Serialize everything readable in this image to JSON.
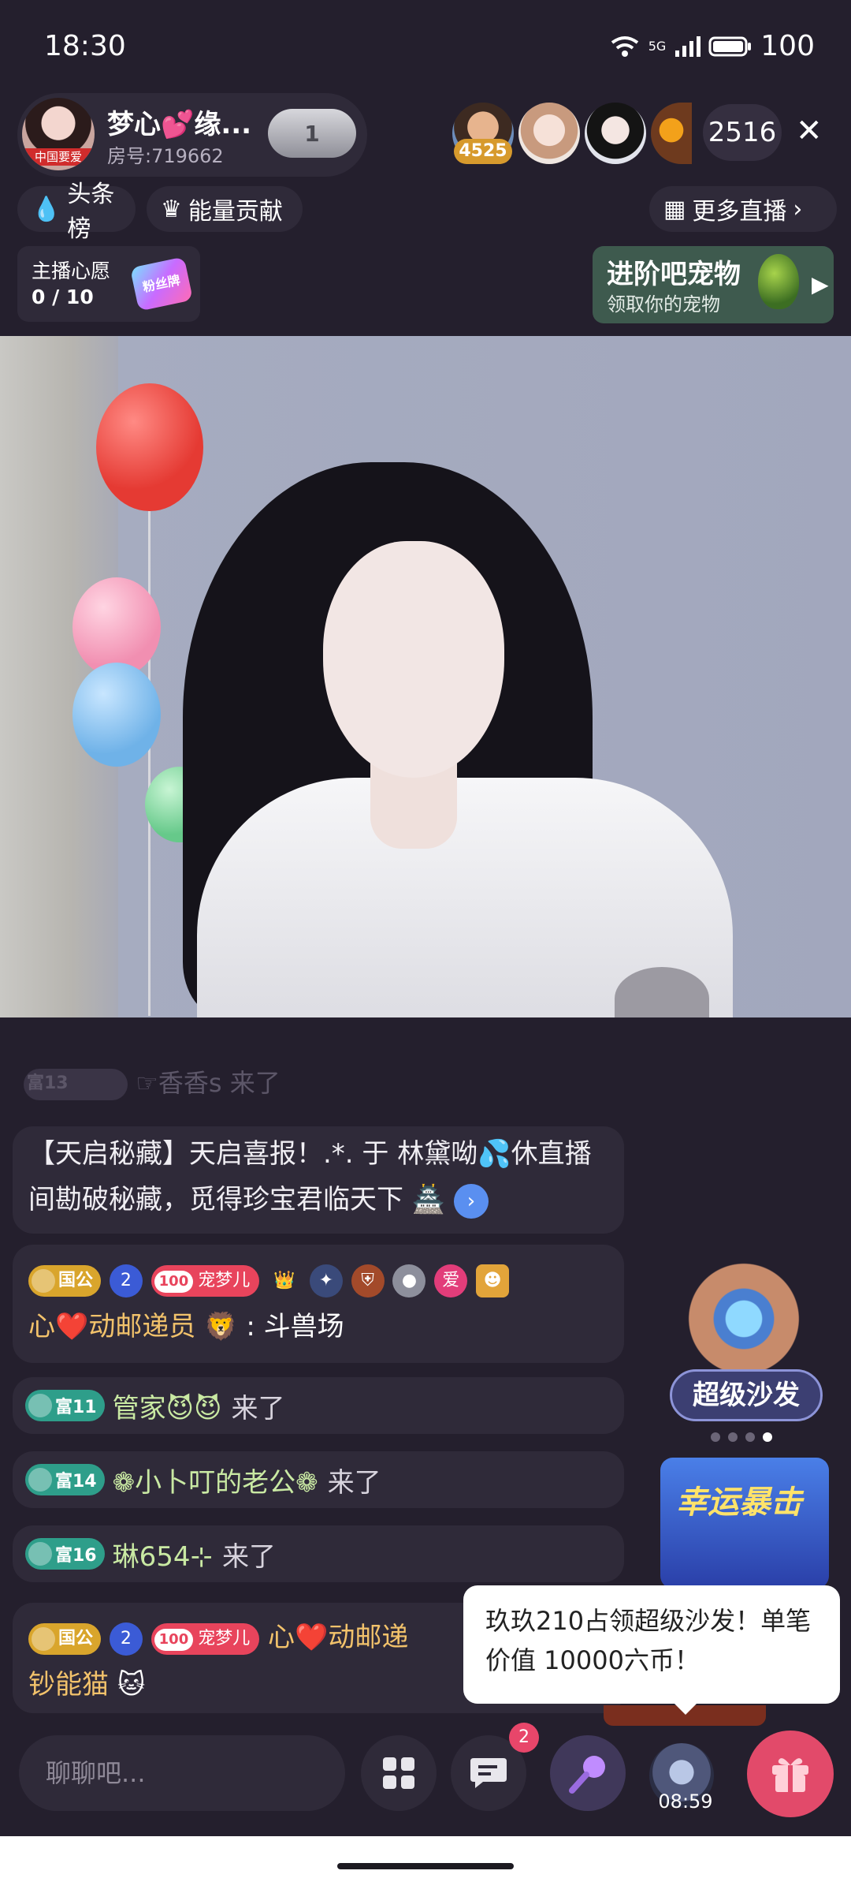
{
  "status_bar": {
    "time": "18:30",
    "battery": "100",
    "network": "5G"
  },
  "anchor": {
    "name": "梦心💕缘...",
    "room": "房号:719662",
    "fan_level": "1",
    "avatar_tag": "中国要爱"
  },
  "viewers": {
    "first_badge": "4525",
    "count": "2516"
  },
  "ranking": {
    "headline": "头条榜",
    "energy": "能量贡献",
    "more_live": "更多直播"
  },
  "wish": {
    "title": "主播心愿",
    "progress": "0 / 10",
    "gift_label": "粉丝牌"
  },
  "pet_banner": {
    "title": "进阶吧宠物",
    "subtitle": "领取你的宠物"
  },
  "chat": {
    "faded": "☞香香s 来了",
    "faded_level": "富13",
    "system": "【天启秘藏】天启喜报！.*. 于 林黛呦💦休直播间勘破秘藏，觅得珍宝君临天下",
    "msg1": {
      "country": "国公",
      "star": "2",
      "pet_num": "100",
      "pet_name": "宠梦儿",
      "love": "爱",
      "user": "心❤️动邮递员",
      "text": ": 斗兽场"
    },
    "joins": [
      {
        "level": "富11",
        "user": "管家😈😈",
        "suffix": "来了"
      },
      {
        "level": "富14",
        "user": "❁小卜叮的老公❁",
        "suffix": "来了"
      },
      {
        "level": "富16",
        "user": "琳654⊹",
        "suffix": "来了"
      }
    ],
    "msg2": {
      "country": "国公",
      "star": "2",
      "pet_num": "100",
      "pet_name": "宠梦儿",
      "user": "心❤️动邮递",
      "user2": "钞能猫"
    }
  },
  "side": {
    "sofa": "超级沙发",
    "lucky": "幸运暴击",
    "carousel_active": 4
  },
  "popup": {
    "text": "玖玖210占领超级沙发！单笔价值 10000六币！"
  },
  "bottom": {
    "input_placeholder": "聊聊吧...",
    "msg_badge": "2",
    "timer": "08:59"
  },
  "colors": {
    "bg": "#241f2d",
    "pill": "#2f2a39",
    "gift": "#e24a6a",
    "level_green": "#2e9e8a"
  }
}
